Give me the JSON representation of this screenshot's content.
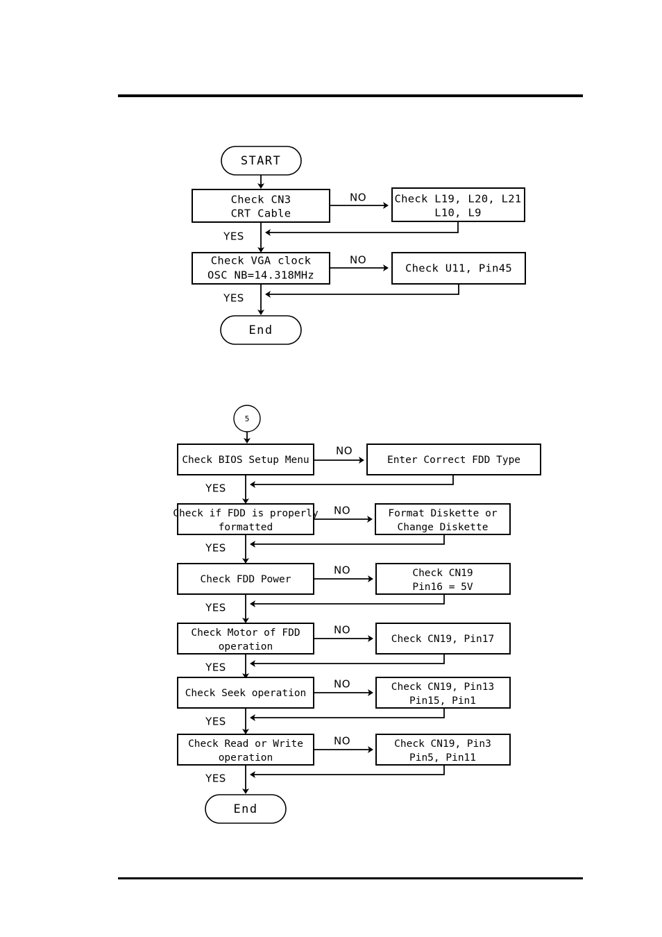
{
  "page": {
    "background_color": "#ffffff",
    "ink_color": "#000000",
    "header_rule": true,
    "footer_rule": true
  },
  "diagrams": [
    {
      "id": "vga-crt-troubleshooting",
      "type": "flowchart",
      "start_label": "START",
      "end_label": "End",
      "yes_label": "YES",
      "no_label": "NO",
      "steps": [
        {
          "check_lines": [
            "Check CN3",
            "CRT Cable"
          ],
          "action_lines": [
            "Check L19, L20, L21",
            "L10, L9"
          ]
        },
        {
          "check_lines": [
            "Check VGA clock",
            "OSC NB=14.318MHz"
          ],
          "action_lines": [
            "Check U11, Pin45"
          ]
        }
      ]
    },
    {
      "id": "fdd-troubleshooting",
      "type": "flowchart",
      "connector_label": "5",
      "end_label": "End",
      "yes_label": "YES",
      "no_label": "NO",
      "steps": [
        {
          "check_lines": [
            "Check BIOS Setup Menu"
          ],
          "action_lines": [
            "Enter Correct FDD Type"
          ]
        },
        {
          "check_lines": [
            "Check if FDD is properly",
            "formatted"
          ],
          "action_lines": [
            "Format Diskette or",
            "Change Diskette"
          ]
        },
        {
          "check_lines": [
            "Check FDD Power"
          ],
          "action_lines": [
            "Check CN19",
            "Pin16 = 5V"
          ]
        },
        {
          "check_lines": [
            "Check Motor of FDD",
            "operation"
          ],
          "action_lines": [
            "Check CN19, Pin17"
          ]
        },
        {
          "check_lines": [
            "Check Seek operation"
          ],
          "action_lines": [
            "Check CN19, Pin13",
            "Pin15, Pin1"
          ]
        },
        {
          "check_lines": [
            "Check Read or Write",
            "operation"
          ],
          "action_lines": [
            "Check CN19, Pin3",
            "Pin5, Pin11"
          ]
        }
      ]
    }
  ]
}
